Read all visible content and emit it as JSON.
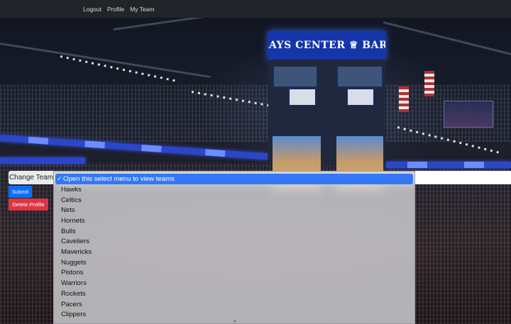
{
  "nav": {
    "links": [
      "Logout",
      "Profile",
      "My Team"
    ]
  },
  "background": {
    "arena_sign": "BARCLAYS CENTER ♕ BARCLAYS"
  },
  "form": {
    "label": "Change Team",
    "submit_label": "Submit",
    "delete_label": "Delete Profile"
  },
  "dropdown": {
    "selected_check": "✓",
    "options": [
      "Open this select menu to view teams",
      "Hawks",
      "Celtics",
      "Nets",
      "Hornets",
      "Bulls",
      "Caveliers",
      "Mavericks",
      "Nuggets",
      "Pistons",
      "Warriors",
      "Rockets",
      "Pacers",
      "Clippers"
    ],
    "scroll_down_glyph": "⌄"
  },
  "colors": {
    "navbar": "#212529",
    "submit": "#0d6efd",
    "delete": "#dc3545",
    "selected_option": "#3478f6"
  }
}
